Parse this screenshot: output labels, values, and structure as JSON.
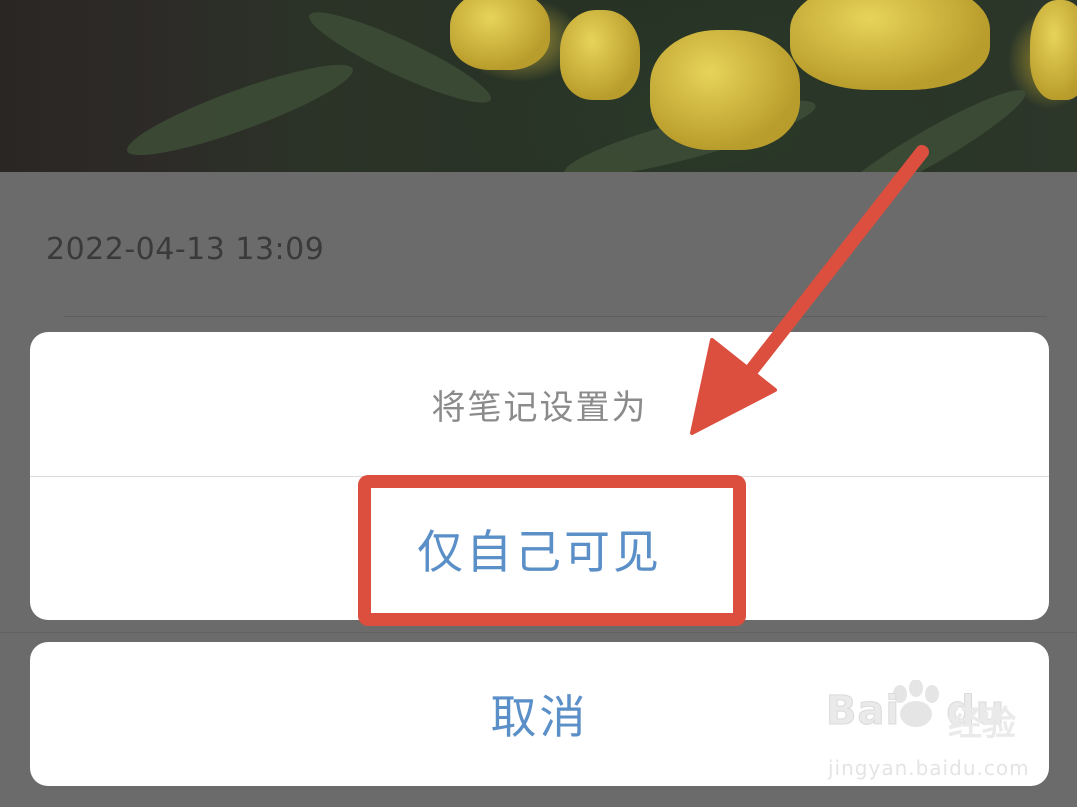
{
  "note": {
    "timestamp": "2022-04-13 13:09"
  },
  "action_sheet": {
    "title": "将笔记设置为",
    "option_private": "仅自己可见",
    "cancel": "取消"
  },
  "watermark": {
    "brand": "Bai",
    "brand_suffix": "du",
    "product": "经验",
    "url": "jingyan.baidu.com"
  },
  "colors": {
    "overlay": "#6b6b6b",
    "sheet_bg": "#ffffff",
    "option_text": "#5b8fc7",
    "title_text": "#8b8b8b",
    "annotation_red": "#dc4f3f"
  }
}
